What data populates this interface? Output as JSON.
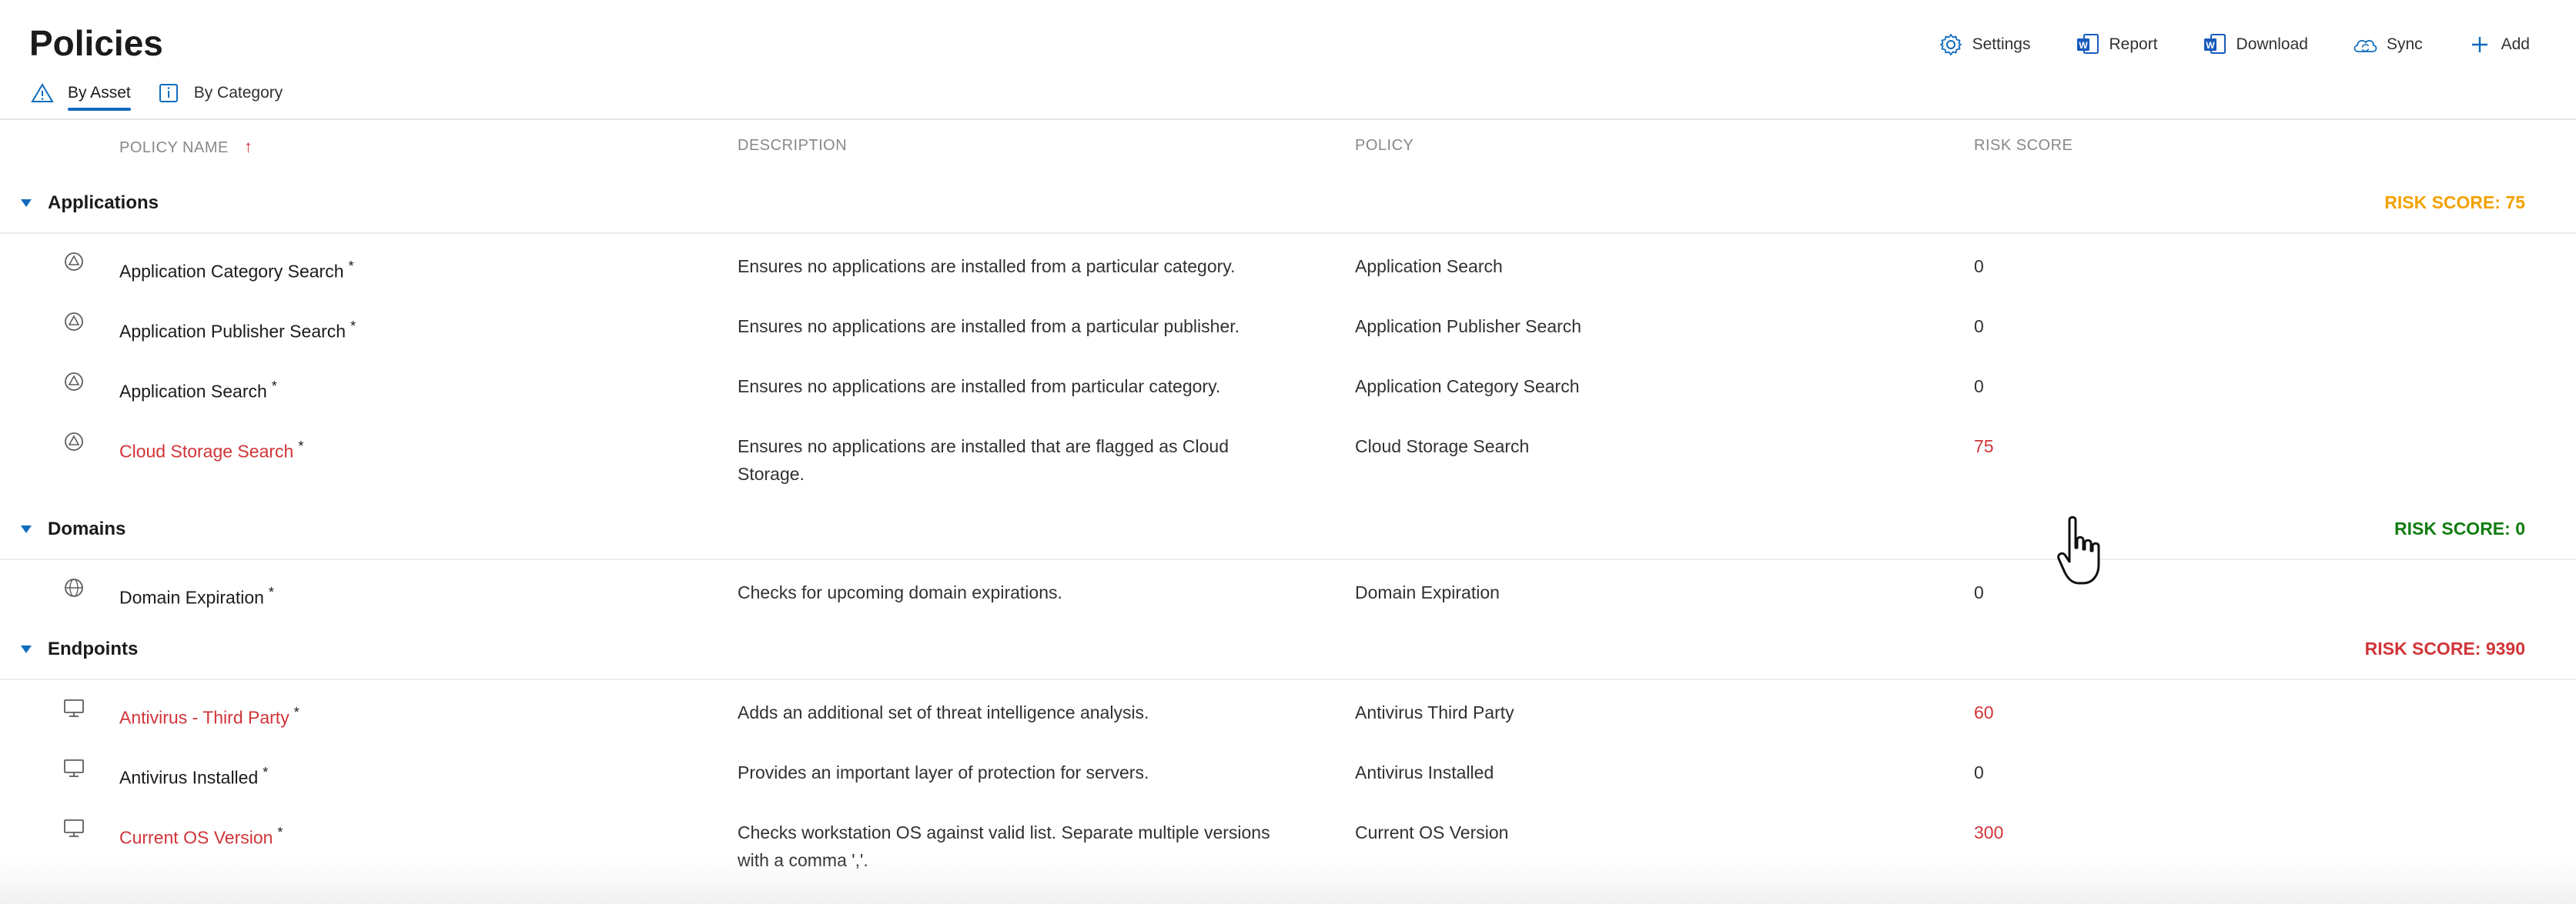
{
  "header": {
    "title": "Policies",
    "tabs": [
      {
        "label": "By Asset",
        "icon": "warning-triangle-icon",
        "active": true
      },
      {
        "label": "By Category",
        "icon": "category-info-icon",
        "active": false
      }
    ],
    "toolbar": [
      {
        "label": "Settings",
        "icon": "gear-icon"
      },
      {
        "label": "Report",
        "icon": "report-icon"
      },
      {
        "label": "Download",
        "icon": "download-icon"
      },
      {
        "label": "Sync",
        "icon": "cloud-sync-icon"
      },
      {
        "label": "Add",
        "icon": "plus-icon"
      }
    ]
  },
  "columns": {
    "policy_name": "POLICY NAME",
    "description": "DESCRIPTION",
    "policy": "POLICY",
    "risk_score": "RISK SCORE",
    "sort_indicator": "↑"
  },
  "groups": [
    {
      "title": "Applications",
      "risk_label": "RISK SCORE: 75",
      "risk_color": "#f2a100",
      "rows": [
        {
          "icon": "application-icon",
          "name": "Application Category Search",
          "required": "*",
          "description": "Ensures no applications are installed from a particular category.",
          "policy": "Application Search",
          "score": "0",
          "alert": false
        },
        {
          "icon": "application-icon",
          "name": "Application Publisher Search",
          "required": "*",
          "description": "Ensures no applications are installed from a particular publisher.",
          "policy": "Application Publisher Search",
          "score": "0",
          "alert": false
        },
        {
          "icon": "application-icon",
          "name": "Application Search",
          "required": "*",
          "description": "Ensures no applications are installed from particular category.",
          "policy": "Application Category Search",
          "score": "0",
          "alert": false
        },
        {
          "icon": "application-icon",
          "name": "Cloud Storage Search",
          "required": "*",
          "description": "Ensures no applications are installed that are flagged as Cloud Storage.",
          "policy": "Cloud Storage Search",
          "score": "75",
          "alert": true
        }
      ]
    },
    {
      "title": "Domains",
      "risk_label": "RISK SCORE: 0",
      "risk_color": "#107c10",
      "rows": [
        {
          "icon": "globe-icon",
          "name": "Domain Expiration",
          "required": "*",
          "description": "Checks for upcoming domain expirations.",
          "policy": "Domain Expiration",
          "score": "0",
          "alert": false
        }
      ]
    },
    {
      "title": "Endpoints",
      "risk_label": "RISK SCORE: 9390",
      "risk_color": "#d13438",
      "rows": [
        {
          "icon": "monitor-icon",
          "name": "Antivirus - Third Party",
          "required": "*",
          "description": "Adds an additional set of threat intelligence analysis.",
          "policy": "Antivirus Third Party",
          "score": "60",
          "alert": true
        },
        {
          "icon": "monitor-icon",
          "name": "Antivirus Installed",
          "required": "*",
          "description": "Provides an important layer of protection for servers.",
          "policy": "Antivirus Installed",
          "score": "0",
          "alert": false
        },
        {
          "icon": "monitor-icon",
          "name": "Current OS Version",
          "required": "*",
          "description": "Checks workstation OS against valid list. Separate multiple versions with a comma ','.",
          "policy": "Current OS Version",
          "score": "300",
          "alert": true
        }
      ]
    }
  ],
  "colors": {
    "accent": "#0f6cbd",
    "alert": "#d13438"
  }
}
